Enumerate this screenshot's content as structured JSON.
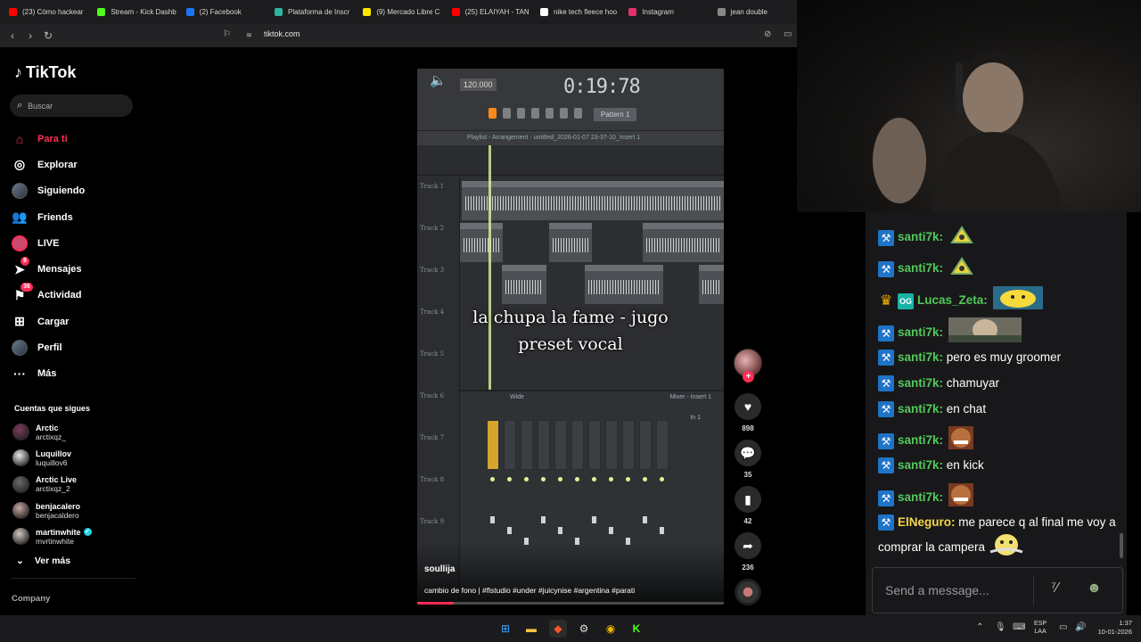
{
  "browser": {
    "tabs": [
      {
        "title": "(23) Cómo hackear",
        "color": "#ff0000"
      },
      {
        "title": "Stream - Kick Dashb",
        "color": "#53fc18"
      },
      {
        "title": "(2) Facebook",
        "color": "#1877f2"
      },
      {
        "title": "Plataforma de Inscr",
        "color": "#2bb5a0"
      },
      {
        "title": "(9) Mercado Libre C",
        "color": "#ffe600"
      },
      {
        "title": "(25) ELAIYAH - TAN",
        "color": "#ff0000"
      },
      {
        "title": "nike tech fleece hoo",
        "color": "#ffffff"
      },
      {
        "title": "Instagram",
        "color": "#e1306c"
      },
      {
        "title": "jean double",
        "color": "#888888"
      }
    ],
    "url": "tiktok.com"
  },
  "tiktok": {
    "logo": "TikTok",
    "search_placeholder": "Buscar",
    "nav": [
      {
        "label": "Para ti",
        "icon": "home-icon"
      },
      {
        "label": "Explorar",
        "icon": "compass-icon"
      },
      {
        "label": "Siguiendo",
        "icon": "following-icon"
      },
      {
        "label": "Friends",
        "icon": "friends-icon"
      },
      {
        "label": "LIVE",
        "icon": "live-icon"
      },
      {
        "label": "Mensajes",
        "icon": "messages-icon",
        "badge": "8"
      },
      {
        "label": "Actividad",
        "icon": "activity-icon",
        "badge": "36"
      },
      {
        "label": "Cargar",
        "icon": "upload-icon"
      },
      {
        "label": "Perfil",
        "icon": "profile-icon"
      },
      {
        "label": "Más",
        "icon": "more-icon"
      }
    ],
    "following_title": "Cuentas que sigues",
    "following": [
      {
        "name": "Arctic",
        "user": "arctixqz_",
        "color": "#7a3b5c"
      },
      {
        "name": "Luquillov",
        "user": "luquillov6",
        "color": "#e8e8e8"
      },
      {
        "name": "Arctic Live",
        "user": "arctixqz_2",
        "color": "#6b6b6b"
      },
      {
        "name": "benjacalero",
        "user": "benjacaldero",
        "color": "#c9a7a0"
      },
      {
        "name": "martinwhite",
        "user": "mvrtinwhite",
        "color": "#d0c7c0",
        "verified": true
      }
    ],
    "see_more": "Ver más",
    "company": "Company"
  },
  "video": {
    "overlay_text": "la chupa la fame - jugo\npreset vocal",
    "author": "soullija",
    "caption": "cambio de fono | #flstudio #under #juicynise #argentina #parati",
    "progress": 0.12,
    "screen": {
      "time": "0:19:78",
      "bpm": "120.000",
      "pattern": "Pattern 1",
      "playlist_title": "Playlist - Arrangement · untitled_2026-01-07 23-37-10_Insert 1",
      "tracks": [
        "Track 1",
        "Track 2",
        "Track 3",
        "Track 4",
        "Track 5",
        "Track 6",
        "Track 7",
        "Track 8",
        "Track 9"
      ],
      "mixer_title": "Mixer - Insert 1",
      "mixer_mode": "Wide",
      "mixer_slot": "In 1"
    }
  },
  "actions": {
    "likes": "898",
    "comments": "35",
    "saves": "42",
    "shares": "236"
  },
  "chat": {
    "messages": [
      {
        "user": "santi7k",
        "badge": "hammer",
        "emote": "tri",
        "color": "#53c95b"
      },
      {
        "user": "santi7k",
        "badge": "hammer",
        "emote": "tri",
        "color": "#53c95b"
      },
      {
        "user": "Lucas_Zeta",
        "badge": "crown-og",
        "emote": "pika",
        "color": "#53c95b"
      },
      {
        "user": "santi7k",
        "badge": "hammer",
        "emote": "photo",
        "color": "#53c95b"
      },
      {
        "user": "santi7k",
        "badge": "hammer",
        "text": "pero es muy groomer",
        "color": "#53c95b"
      },
      {
        "user": "santi7k",
        "badge": "hammer",
        "text": "chamuyar",
        "color": "#53c95b"
      },
      {
        "user": "santi7k",
        "badge": "hammer",
        "text": "en chat",
        "color": "#53c95b"
      },
      {
        "user": "santi7k",
        "badge": "hammer",
        "emote": "face",
        "color": "#53c95b"
      },
      {
        "user": "santi7k",
        "badge": "hammer",
        "text": "en kick",
        "color": "#53c95b"
      },
      {
        "user": "santi7k",
        "badge": "hammer",
        "emote": "face",
        "color": "#53c95b"
      },
      {
        "user": "ElNeguro",
        "badge": "hammer",
        "text": "me parece q al final me voy a comprar la campera",
        "emote": "smile",
        "color": "#f5d547"
      }
    ],
    "input_placeholder": "Send a message..."
  },
  "taskbar": {
    "lang": "ESP\nLAA",
    "time": "1:37",
    "date": "10-01-2026"
  }
}
